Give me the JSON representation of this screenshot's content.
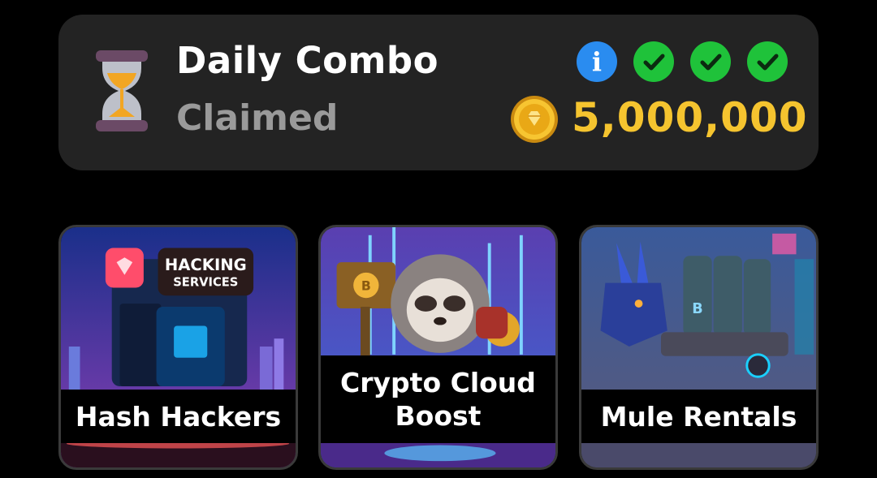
{
  "daily_combo": {
    "title": "Daily Combo",
    "status": "Claimed",
    "info_symbol": "i",
    "completed_checks": 3,
    "reward": "5,000,000",
    "icons": [
      "hourglass-icon",
      "info-icon",
      "checkmark-icon",
      "coin-icon"
    ],
    "colors": {
      "panel": "#232323",
      "info": "#2a8cf0",
      "check": "#1fc23a",
      "reward": "#f5c42f",
      "status": "#9a9a9a"
    }
  },
  "cards": [
    {
      "label": "Hash Hackers",
      "sign_line1": "HACKING",
      "sign_line2": "SERVICES"
    },
    {
      "label": "Crypto Cloud Boost",
      "coin_symbol": "B"
    },
    {
      "label": "Mule Rentals",
      "barrel_symbol": "B"
    }
  ]
}
